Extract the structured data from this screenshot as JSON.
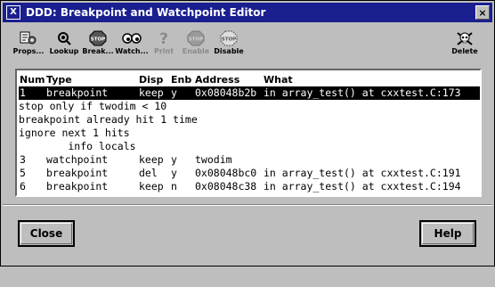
{
  "window": {
    "title": "DDD: Breakpoint and Watchpoint Editor",
    "sys_icon": "x-mark",
    "close_glyph": "×"
  },
  "toolbar": [
    {
      "label": "Props...",
      "icon": "props-icon",
      "enabled": true
    },
    {
      "label": "Lookup",
      "icon": "lookup-icon",
      "enabled": true
    },
    {
      "label": "Break...",
      "icon": "stop-sign-icon",
      "enabled": true
    },
    {
      "label": "Watch...",
      "icon": "watch-eyes-icon",
      "enabled": true
    },
    {
      "label": "Print",
      "icon": "question-icon",
      "enabled": false
    },
    {
      "label": "Enable",
      "icon": "enable-stop-icon",
      "enabled": false
    },
    {
      "label": "Disable",
      "icon": "disable-stop-icon",
      "enabled": true
    },
    {
      "label": "Delete",
      "icon": "delete-skull-icon",
      "enabled": true
    }
  ],
  "table": {
    "headers": {
      "num": "Num",
      "type": "Type",
      "disp": "Disp",
      "enb": "Enb",
      "address": "Address",
      "what": "What"
    },
    "rows": [
      {
        "kind": "entry",
        "selected": true,
        "num": "1",
        "type": "breakpoint",
        "disp": "keep",
        "enb": "y",
        "address": "0x08048b2b",
        "what": "in array_test() at cxxtest.C:173"
      },
      {
        "kind": "note",
        "text": "stop only if twodim < 10"
      },
      {
        "kind": "note",
        "text": "breakpoint already hit 1 time"
      },
      {
        "kind": "note",
        "text": "ignore next 1 hits"
      },
      {
        "kind": "note",
        "text": "        info locals"
      },
      {
        "kind": "entry",
        "selected": false,
        "num": "3",
        "type": "watchpoint",
        "disp": "keep",
        "enb": "y",
        "address": "twodim",
        "what": ""
      },
      {
        "kind": "entry",
        "selected": false,
        "num": "5",
        "type": "breakpoint",
        "disp": "del",
        "enb": "y",
        "address": "0x08048bc0",
        "what": "in array_test() at cxxtest.C:191"
      },
      {
        "kind": "entry",
        "selected": false,
        "num": "6",
        "type": "breakpoint",
        "disp": "keep",
        "enb": "n",
        "address": "0x08048c38",
        "what": "in array_test() at cxxtest.C:194"
      }
    ]
  },
  "buttons": {
    "close": "Close",
    "help": "Help"
  },
  "colors": {
    "titlebar": "#1a1f8f",
    "background": "#bebebe",
    "selection": "#000000",
    "list_background": "#ffffff"
  }
}
